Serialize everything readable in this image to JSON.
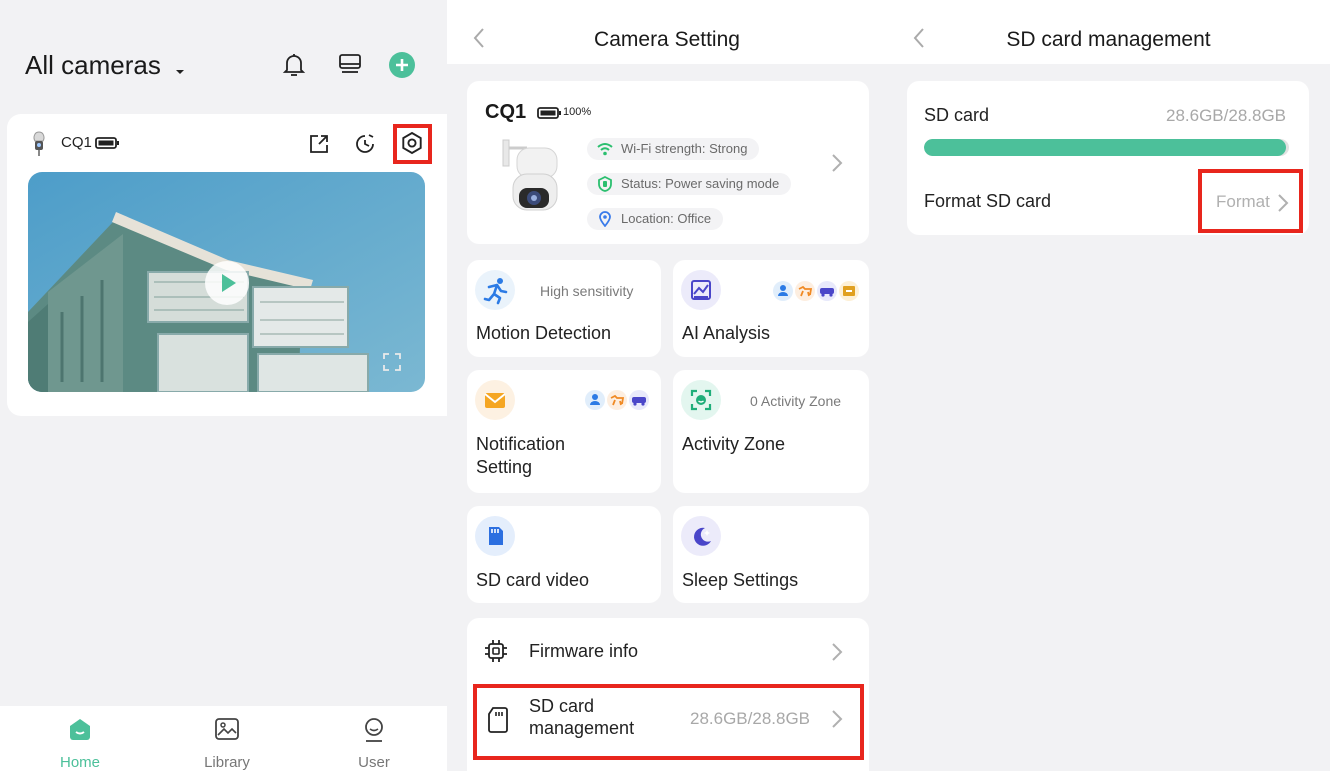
{
  "home": {
    "title": "All cameras",
    "camera": {
      "name": "CQ1"
    },
    "tabs": [
      {
        "label": "Home",
        "active": true
      },
      {
        "label": "Library",
        "active": false
      },
      {
        "label": "User",
        "active": false
      }
    ]
  },
  "camera_setting": {
    "title": "Camera Setting",
    "device": {
      "name": "CQ1",
      "battery": "100%",
      "wifi": "Wi-Fi strength: Strong",
      "status": "Status: Power saving mode",
      "location": "Location: Office"
    },
    "tiles": {
      "motion": {
        "title": "Motion Detection",
        "sub": "High sensitivity"
      },
      "ai": {
        "title": "AI Analysis"
      },
      "notification": {
        "title_line1": "Notification",
        "title_line2": "Setting"
      },
      "zone": {
        "title": "Activity Zone",
        "sub": "0 Activity Zone"
      },
      "sdvideo": {
        "title": "SD card video"
      },
      "sleep": {
        "title": "Sleep Settings"
      }
    },
    "firmware": {
      "label": "Firmware info"
    },
    "sd_management": {
      "label_line1": "SD card",
      "label_line2": "management",
      "value": "28.6GB/28.8GB"
    }
  },
  "sd_card": {
    "title": "SD card management",
    "storage_label": "SD card",
    "storage_value": "28.6GB/28.8GB",
    "usage_fraction": 0.993,
    "format_label": "Format SD card",
    "format_action": "Format"
  },
  "colors": {
    "accent": "#4cc09a",
    "highlight": "#e8261d",
    "battery_green": "#3cb37a"
  }
}
